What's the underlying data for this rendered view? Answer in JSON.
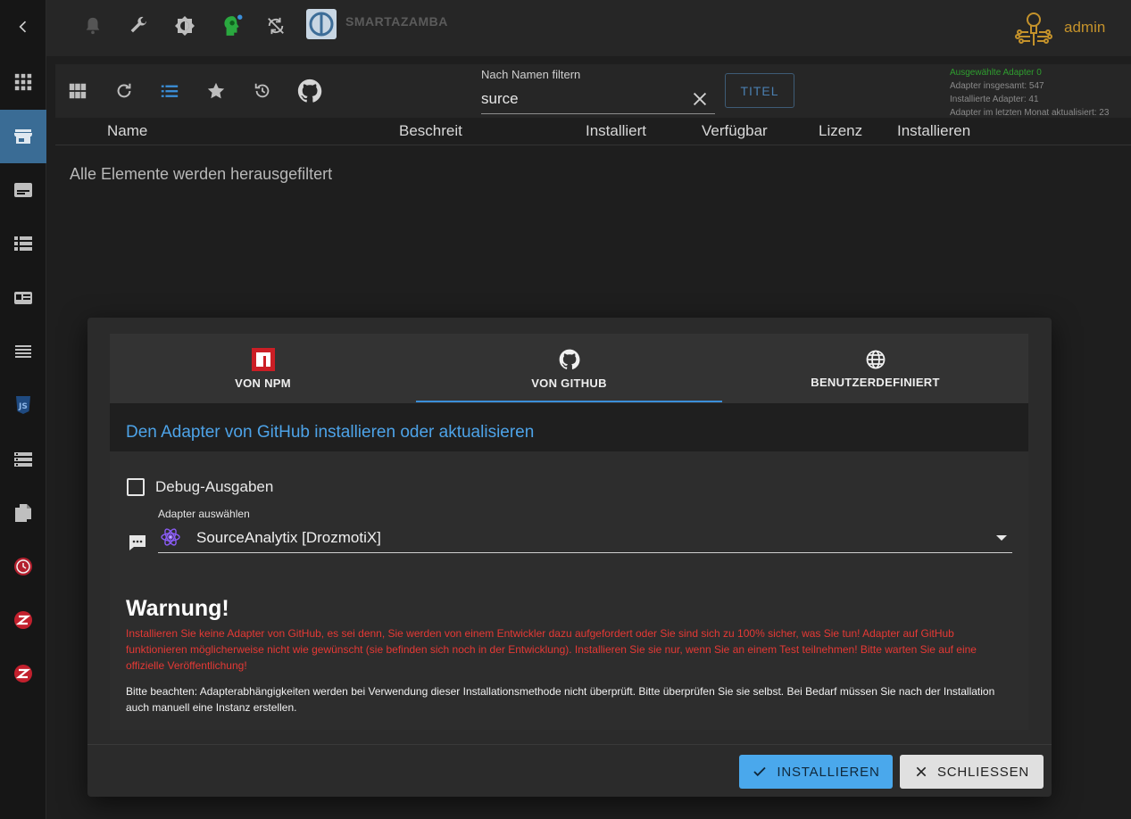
{
  "topbar": {
    "brand": "SMARTAZAMBA",
    "user": "admin"
  },
  "toolbar": {
    "filter_label": "Nach Namen filtern",
    "filter_value": "surce",
    "title_button": "TITEL"
  },
  "stats": {
    "selected": "Ausgewählte Adapter 0",
    "total": "Adapter insgesamt: 547",
    "installed": "Installierte Adapter: 41",
    "updated": "Adapter im letzten Monat aktualisiert: 23"
  },
  "columns": [
    "Name",
    "Beschreit",
    "Installiert",
    "Verfügbar",
    "Lizenz",
    "Installieren"
  ],
  "empty_message": "Alle Elemente werden herausgefiltert",
  "dialog": {
    "tabs": [
      {
        "label": "VON NPM"
      },
      {
        "label": "VON GITHUB"
      },
      {
        "label": "BENUTZERDEFINIERT"
      }
    ],
    "active_tab": 1,
    "title": "Den Adapter von GitHub installieren oder aktualisieren",
    "checkbox_label": "Debug-Ausgaben",
    "checkbox_checked": false,
    "select_label": "Adapter auswählen",
    "select_value": "SourceAnalytix [DrozmotiX]",
    "warning_title": "Warnung!",
    "warning_text": "Installieren Sie keine Adapter von GitHub, es sei denn, Sie werden von einem Entwickler dazu aufgefordert oder Sie sind sich zu 100% sicher, was Sie tun! Adapter auf GitHub funktionieren möglicherweise nicht wie gewünscht (sie befinden sich noch in der Entwicklung). Installieren Sie sie nur, wenn Sie an einem Test teilnehmen! Bitte warten Sie auf eine offizielle Veröffentlichung!",
    "note_text": "Bitte beachten: Adapterabhängigkeiten werden bei Verwendung dieser Installationsmethode nicht überprüft. Bitte überprüfen Sie sie selbst. Bei Bedarf müssen Sie nach der Installation auch manuell eine Instanz erstellen.",
    "install_button": "INSTALLIEREN",
    "close_button": "SCHLIESSEN"
  },
  "colors": {
    "accent": "#4aa8ec",
    "warning": "#e53935",
    "sidebar_active": "#3a6c95",
    "admin": "#c4922b"
  }
}
